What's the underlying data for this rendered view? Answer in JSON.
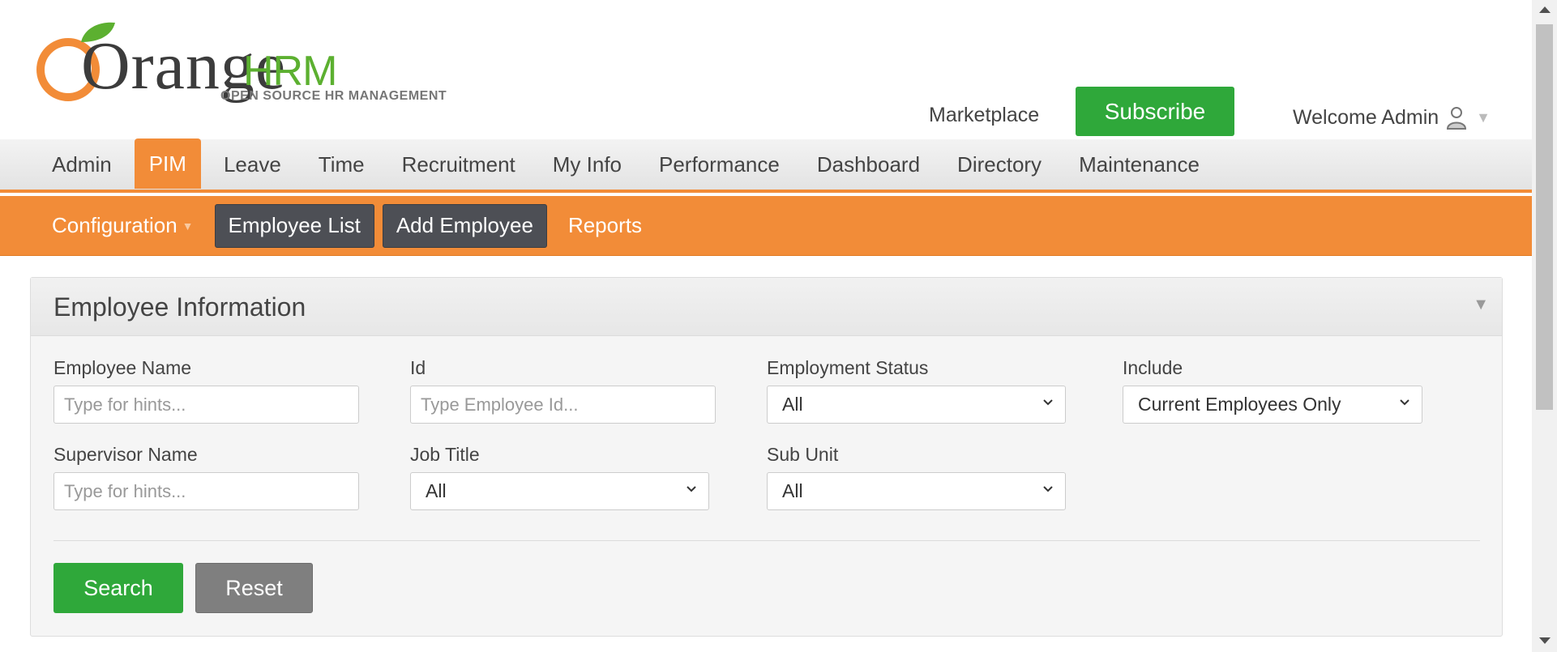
{
  "brand": {
    "logo_text_orange": "Orange",
    "logo_text_hrm": "HRM",
    "tagline": "OPEN SOURCE HR MANAGEMENT",
    "colors": {
      "orange": "#f28c38",
      "green": "#2fa83a",
      "leaf_green": "#5cb030"
    }
  },
  "header": {
    "marketplace_label": "Marketplace",
    "subscribe_label": "Subscribe",
    "welcome_label": "Welcome Admin",
    "user_icon": "user-icon"
  },
  "main_nav": {
    "items": [
      {
        "label": "Admin",
        "active": false
      },
      {
        "label": "PIM",
        "active": true
      },
      {
        "label": "Leave",
        "active": false
      },
      {
        "label": "Time",
        "active": false
      },
      {
        "label": "Recruitment",
        "active": false
      },
      {
        "label": "My Info",
        "active": false
      },
      {
        "label": "Performance",
        "active": false
      },
      {
        "label": "Dashboard",
        "active": false
      },
      {
        "label": "Directory",
        "active": false
      },
      {
        "label": "Maintenance",
        "active": false
      }
    ]
  },
  "sub_nav": {
    "configuration": "Configuration",
    "employee_list": "Employee List",
    "add_employee": "Add Employee",
    "reports": "Reports"
  },
  "panel": {
    "title": "Employee Information",
    "fields": {
      "employee_name": {
        "label": "Employee Name",
        "placeholder": "Type for hints...",
        "value": ""
      },
      "id": {
        "label": "Id",
        "placeholder": "Type Employee Id...",
        "value": ""
      },
      "employment_status": {
        "label": "Employment Status",
        "value": "All"
      },
      "include": {
        "label": "Include",
        "value": "Current Employees Only"
      },
      "supervisor_name": {
        "label": "Supervisor Name",
        "placeholder": "Type for hints...",
        "value": ""
      },
      "job_title": {
        "label": "Job Title",
        "value": "All"
      },
      "sub_unit": {
        "label": "Sub Unit",
        "value": "All"
      }
    },
    "search_label": "Search",
    "reset_label": "Reset"
  }
}
